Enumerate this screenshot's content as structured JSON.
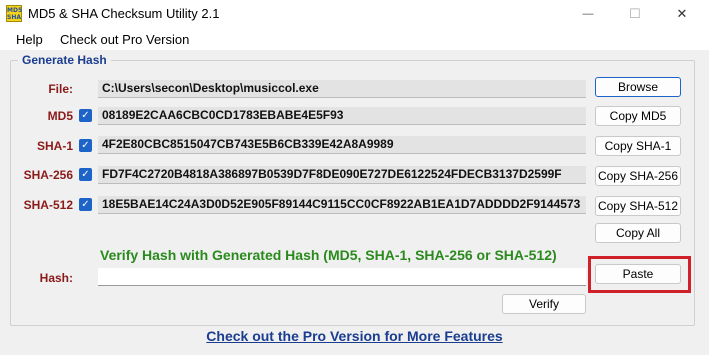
{
  "window": {
    "title": "MD5 & SHA Checksum Utility 2.1",
    "icon_text_top": "MD5",
    "icon_text_bottom": "SHA",
    "minimize_glyph": "—",
    "maximize_glyph": "☐",
    "close_glyph": "✕"
  },
  "menu": {
    "help": "Help",
    "pro": "Check out Pro Version"
  },
  "group": {
    "legend": "Generate Hash"
  },
  "file": {
    "label": "File:",
    "value": "C:\\Users\\secon\\Desktop\\musiccol.exe",
    "browse_label": "Browse"
  },
  "rows": [
    {
      "label": "MD5",
      "checked": true,
      "value": "08189E2CAA6CBC0CD1783EBABE4E5F93",
      "button": "Copy MD5"
    },
    {
      "label": "SHA-1",
      "checked": true,
      "value": "4F2E80CBC8515047CB743E5B6CB339E42A8A9989",
      "button": "Copy SHA-1"
    },
    {
      "label": "SHA-256",
      "checked": true,
      "value": "FD7F4C2720B4818A386897B0539D7F8DE090E727DE6122524FDECB3137D2599F",
      "button": "Copy SHA-256"
    },
    {
      "label": "SHA-512",
      "checked": true,
      "value": "18E5BAE14C24A3D0D52E905F89144C9115CC0CF8922AB1EA1D7ADDDD2F9144573",
      "button": "Copy SHA-512"
    }
  ],
  "copy_all_label": "Copy All",
  "verify": {
    "heading": "Verify Hash with Generated Hash (MD5, SHA-1, SHA-256 or SHA-512)",
    "hash_label": "Hash:",
    "hash_value": "",
    "paste_label": "Paste",
    "verify_label": "Verify"
  },
  "footer_link": "Check out the Pro Version for More Features",
  "colors": {
    "accent": "#1e64c8",
    "label_red": "#8b1a1a",
    "heading_green": "#2b8a1d",
    "highlight": "#d0202a",
    "link_blue": "#1a3d8f"
  }
}
